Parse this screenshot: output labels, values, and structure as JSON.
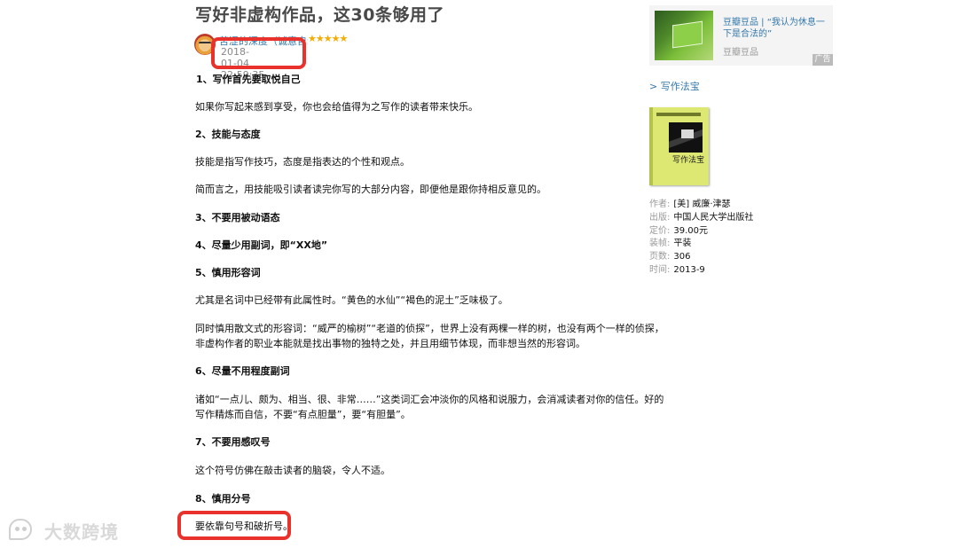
{
  "article": {
    "title": "写好非虚构作品，这30条够用了",
    "author": "苦涩的深度（诚意自动）",
    "rating_stars": "★★★★★",
    "date": "2018-01-04 22:59:35",
    "paragraphs": [
      {
        "text": "1、写作首先要取悦自己",
        "heading": true
      },
      {
        "text": "如果你写起来感到享受，你也会给值得为之写作的读者带来快乐。",
        "heading": false
      },
      {
        "text": "2、技能与态度",
        "heading": true
      },
      {
        "text": "技能是指写作技巧，态度是指表达的个性和观点。",
        "heading": false
      },
      {
        "text": "简而言之，用技能吸引读者读完你写的大部分内容，即便他是跟你持相反意见的。",
        "heading": false
      },
      {
        "text": "3、不要用被动语态",
        "heading": true
      },
      {
        "text": "4、尽量少用副词，即“XX地”",
        "heading": true
      },
      {
        "text": "5、慎用形容词",
        "heading": true
      },
      {
        "text": "尤其是名词中已经带有此属性时。“黄色的水仙”“褐色的泥土”乏味极了。",
        "heading": false
      },
      {
        "text": "同时慎用散文式的形容词：“威严的榆树”“老道的侦探”，世界上没有两棵一样的树，也没有两个一样的侦探，",
        "heading": false
      },
      {
        "text": "非虚构作者的职业本能就是找出事物的独特之处，并且用细节体现，而非想当然的形容词。",
        "heading": false
      },
      {
        "text": "6、尽量不用程度副词",
        "heading": true
      },
      {
        "text": "诸如“一点儿、颇为、相当、很、非常……”这类词汇会冲淡你的风格和说服力，会消减读者对你的信任。好的",
        "heading": false
      },
      {
        "text": "写作精炼而自信，不要“有点胆量”，要“有胆量”。",
        "heading": false
      },
      {
        "text": "7、不要用感叹号",
        "heading": true
      },
      {
        "text": "这个符号仿佛在敲击读者的脑袋，令人不适。",
        "heading": false
      },
      {
        "text": "8、慎用分号",
        "heading": true
      },
      {
        "text": "要依靠句号和破折号。",
        "heading": false
      }
    ]
  },
  "sidebar": {
    "ad": {
      "text": "豆瓣豆品 | “我认为休息一下是合法的”",
      "source": "豆瓣豆品",
      "badge": "广告"
    },
    "section_link": "> 写作法宝",
    "book": {
      "cover_title": "写作法宝",
      "meta": [
        {
          "key": "作者:",
          "value": "[美] 威廉·津瑟"
        },
        {
          "key": "出版:",
          "value": "中国人民大学出版社"
        },
        {
          "key": "定价:",
          "value": "39.00元"
        },
        {
          "key": "装帧:",
          "value": "平装"
        },
        {
          "key": "页数:",
          "value": "306"
        },
        {
          "key": "时间:",
          "value": "2013-9"
        }
      ]
    }
  },
  "watermark": {
    "text": "大数跨境"
  },
  "colors": {
    "link": "#3377aa",
    "highlight": "#e8322b",
    "star": "#f6ab00"
  }
}
